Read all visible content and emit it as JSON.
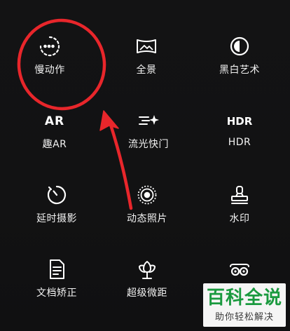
{
  "modes": [
    {
      "label": "慢动作",
      "icon": "slow-motion-icon"
    },
    {
      "label": "全景",
      "icon": "panorama-icon"
    },
    {
      "label": "黑白艺术",
      "icon": "black-white-icon"
    },
    {
      "label": "趣AR",
      "icon": "ar-icon"
    },
    {
      "label": "流光快门",
      "icon": "light-shutter-icon"
    },
    {
      "label": "HDR",
      "icon": "hdr-icon",
      "icon_text": "HDR"
    },
    {
      "label": "延时摄影",
      "icon": "timelapse-icon"
    },
    {
      "label": "动态照片",
      "icon": "moving-picture-icon"
    },
    {
      "label": "水印",
      "icon": "watermark-stamp-icon"
    },
    {
      "label": "文档矫正",
      "icon": "document-icon"
    },
    {
      "label": "超级微距",
      "icon": "super-macro-icon"
    },
    {
      "label": "",
      "icon": "dual-view-icon"
    }
  ],
  "ar_icon_text": "AR",
  "watermark": {
    "title": "百科全说",
    "subtitle": "助你轻松解决"
  },
  "colors": {
    "background": "#111112",
    "text": "#f2f2f2",
    "annotation": "#e8262b",
    "watermark_green": "#1a9a3f"
  }
}
